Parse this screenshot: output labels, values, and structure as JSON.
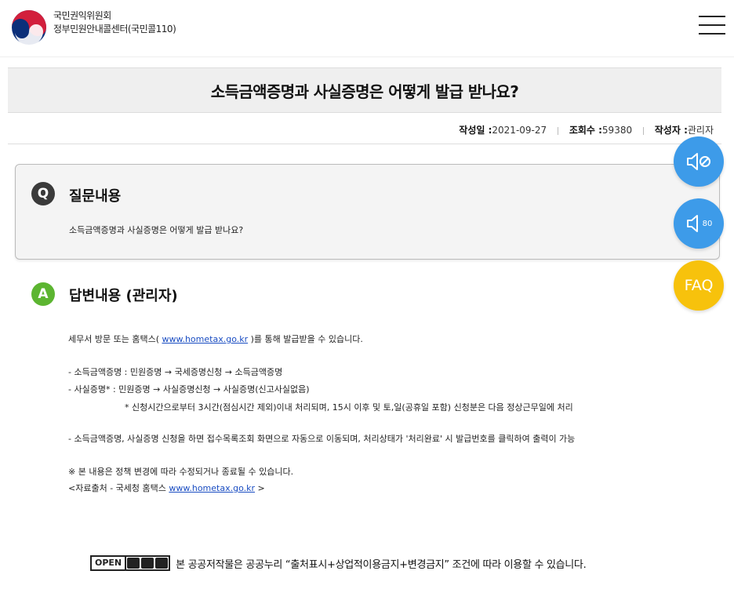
{
  "header": {
    "org_line1": "국민권익위원회",
    "org_line2": "정부민원안내콜센터(국민콜110)",
    "logo_icon": "taegeuk-logo-icon",
    "menu_icon": "hamburger-menu-icon"
  },
  "article": {
    "title": "소득금액증명과 사실증명은 어떻게 발급 받나요?",
    "meta": {
      "date_label": "작성일 :",
      "date_value": "2021-09-27",
      "views_label": "조회수 :",
      "views_value": "59380",
      "author_label": "작성자 :",
      "author_value": "관리자"
    }
  },
  "question": {
    "badge": "Q",
    "title": "질문내용",
    "text": "소득금액증명과 사실증명은 어떻게 발급 받나요?"
  },
  "answer": {
    "badge": "A",
    "title": "답변내용 (관리자)",
    "line1_pre": "세무서 방문 또는 홈택스( ",
    "line1_link": "www.hometax.go.kr",
    "line1_post": " )를 통해 발급받을 수 있습니다.",
    "line2": "- 소득금액증명 : 민원증명 → 국세증명신청 → 소득금액증명",
    "line3": "- 사실증명* : 민원증명 → 사실증명신청 → 사실증명(신고사실없음)",
    "line4": "* 신청시간으로부터 3시간(점심시간 제외)이내 처리되며, 15시 이후 및 토,일(공휴일 포함) 신청분은 다음 정상근무일에 처리",
    "line5": "- 소득금액증명, 사실증명 신청을 하면 접수목록조회 화면으로 자동으로 이동되며, 처리상태가 '처리완료' 시 발급번호를 클릭하여 출력이 가능",
    "line6": "※ 본 내용은 정책 변경에 따라 수정되거나 종료될 수 있습니다.",
    "line7_pre": "<자료출처 - 국세청 홈택스 ",
    "line7_link": "www.hometax.go.kr",
    "line7_post": " >"
  },
  "floating": {
    "mute_icon": "speaker-mute-icon",
    "volume_icon": "speaker-icon",
    "volume_value": "80",
    "faq_label": "FAQ",
    "colors": {
      "speaker": "#3d9be9",
      "faq": "#f7c20c"
    }
  },
  "footer": {
    "kogl_open": "OPEN",
    "kogl_icon": "kogl-license-icon",
    "text": "본 공공저작물은 공공누리 “출처표시+상업적이용금지+변경금지” 조건에 따라 이용할 수 있습니다."
  },
  "colors": {
    "q_badge": "#3a3a3a",
    "a_badge": "#5cb531",
    "link": "#1a4dc2"
  }
}
